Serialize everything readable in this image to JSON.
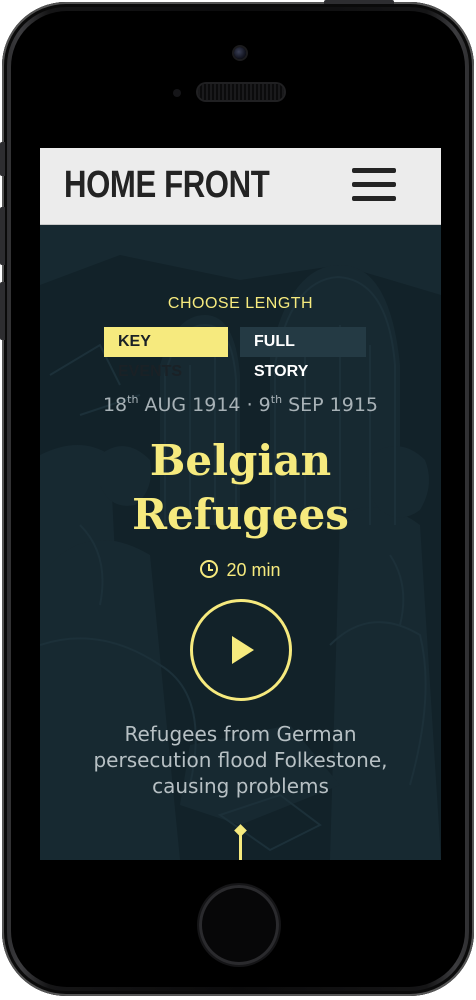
{
  "app": {
    "brand": "HOME FRONT",
    "menu_icon": "hamburger-menu-icon"
  },
  "story": {
    "choose_length_label": "CHOOSE LENGTH",
    "length_options": [
      {
        "label": "KEY EVENTS",
        "selected": true
      },
      {
        "label": "FULL STORY",
        "selected": false
      }
    ],
    "start_day": "18",
    "start_suffix": "th",
    "start_rest": "AUG 1914",
    "separator": "·",
    "end_day": "9",
    "end_suffix": "th",
    "end_rest": "SEP 1915",
    "title": "Belgian Refugees",
    "duration": "20 min",
    "duration_icon": "clock-icon",
    "play_icon": "play-icon",
    "description": "Refugees from German persecution flood Folkestone, causing problems"
  },
  "colors": {
    "accent": "#f6ea7e",
    "hero_background": "#14252d",
    "navbar_background": "#ececec",
    "inactive_button": "#243a44"
  }
}
